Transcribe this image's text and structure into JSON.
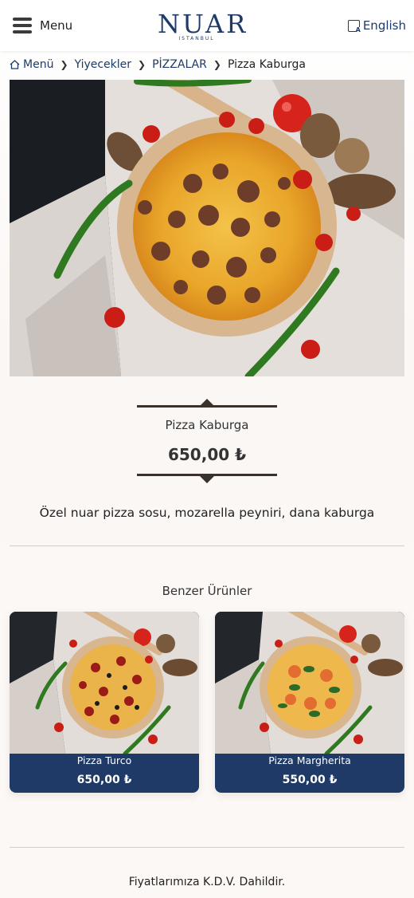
{
  "header": {
    "menu_label": "Menu",
    "logo_main": "NUAR",
    "logo_sub": "ISTANBUL",
    "language_label": "English"
  },
  "breadcrumb": {
    "items": [
      "Menü",
      "Yiyecekler",
      "PİZZALAR"
    ],
    "current": "Pizza Kaburga"
  },
  "product": {
    "name": "Pizza Kaburga",
    "price": "650,00 ₺",
    "description": "Özel nuar pizza sosu, mozarella peyniri, dana kaburga"
  },
  "similar": {
    "title": "Benzer Ürünler",
    "items": [
      {
        "name": "Pizza Turco",
        "price": "650,00 ₺"
      },
      {
        "name": "Pizza Margherita",
        "price": "550,00 ₺"
      }
    ]
  },
  "footer": {
    "note": "Fiyatlarımıza K.D.V. Dahildir."
  },
  "colors": {
    "brand": "#1e3a67",
    "card_bg": "#1f3a66",
    "ornament": "#3a302c"
  }
}
